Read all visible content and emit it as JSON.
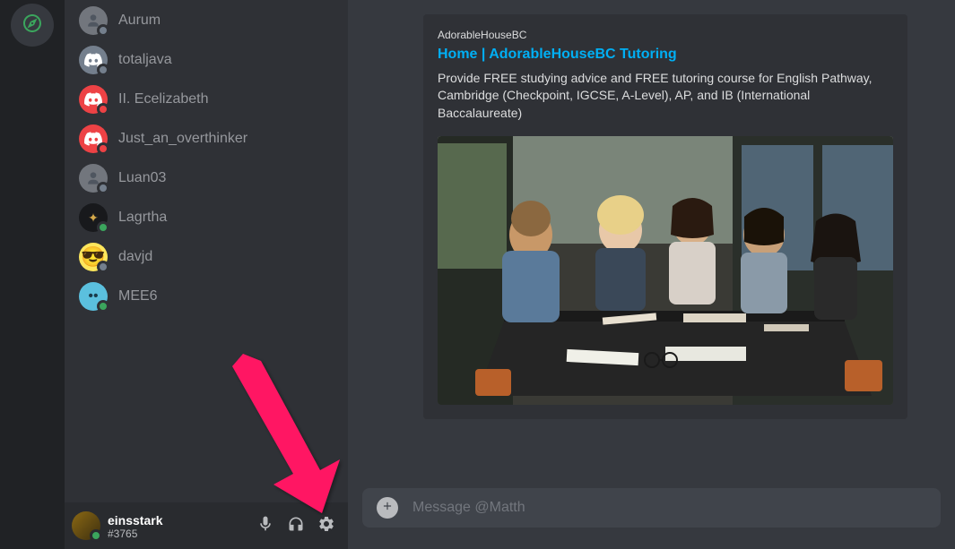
{
  "sidebar": {
    "members": [
      {
        "name": "Aurum",
        "avatar_type": "gray",
        "status": "offline",
        "icon": "person"
      },
      {
        "name": "totaljava",
        "avatar_type": "discord-gray",
        "status": "offline",
        "icon": "discord"
      },
      {
        "name": "II. Ecelizabeth",
        "avatar_type": "discord-red",
        "status": "dnd",
        "icon": "discord"
      },
      {
        "name": "Just_an_overthinker",
        "avatar_type": "discord-red",
        "status": "dnd",
        "icon": "discord"
      },
      {
        "name": "Luan03",
        "avatar_type": "gray",
        "status": "offline",
        "icon": "person"
      },
      {
        "name": "Lagrtha",
        "avatar_type": "dark",
        "status": "online",
        "icon": "stars"
      },
      {
        "name": "davjd",
        "avatar_type": "yellow",
        "status": "offline",
        "icon": "emoji"
      },
      {
        "name": "MEE6",
        "avatar_type": "blue",
        "status": "online",
        "icon": "mee6"
      }
    ]
  },
  "user_panel": {
    "username": "einsstark",
    "discriminator": "#3765"
  },
  "embed": {
    "provider": "AdorableHouseBC",
    "title": "Home | AdorableHouseBC Tutoring",
    "description": "Provide FREE studying advice and FREE tutoring course for English Pathway, Cambridge (Checkpoint, IGCSE, A-Level), AP, and IB (International Baccalaureate)"
  },
  "message_input": {
    "placeholder": "Message @Matth"
  }
}
